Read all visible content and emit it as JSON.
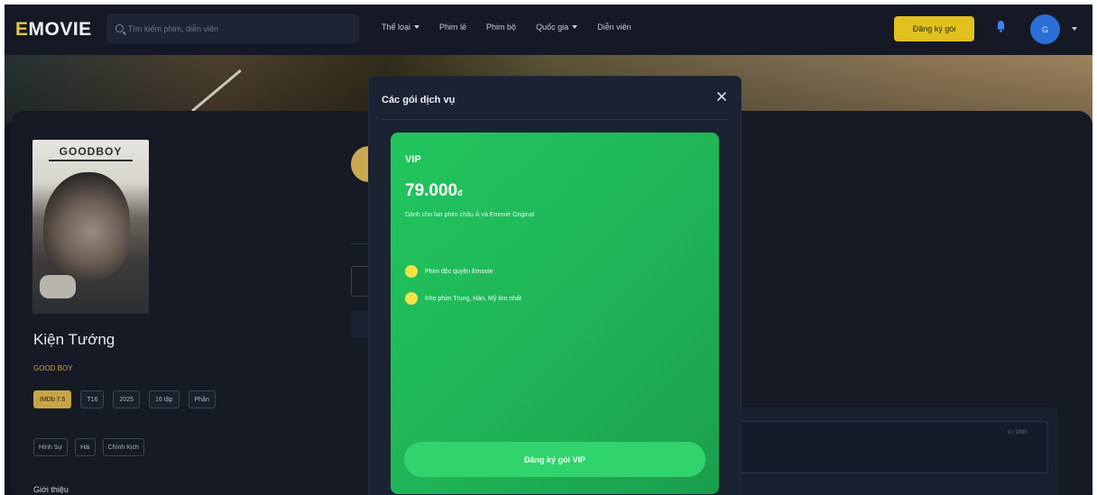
{
  "header": {
    "logo_first_letter": "E",
    "logo_rest": "MOVIE",
    "search_placeholder": "Tìm kiếm phim, diễn viên",
    "menu": [
      {
        "label": "Thể loại",
        "has_caret": true
      },
      {
        "label": "Phim lẻ",
        "has_caret": false
      },
      {
        "label": "Phim bộ",
        "has_caret": false
      },
      {
        "label": "Quốc gia",
        "has_caret": true
      },
      {
        "label": "Diễn viên",
        "has_caret": false
      }
    ],
    "signup_button": "Đăng ký gói",
    "avatar_initial": "G",
    "notification_icon": "bell-icon"
  },
  "movie": {
    "poster_title": "GOODBOY",
    "title": "Kiện Tướng",
    "subtitle": "GOOD BOY",
    "tags": [
      "IMDb 7.5",
      "T16",
      "2025",
      "16 tập",
      "Phần"
    ],
    "genres": [
      "Hình Sự",
      "Hài",
      "Chính Kịch"
    ],
    "intro_label": "Giới thiệu",
    "comment_count": "0 / 1000"
  },
  "modal": {
    "title": "Các gói dịch vụ",
    "close_icon": "close-icon",
    "plan": {
      "name": "VIP",
      "price": "79.000",
      "currency": "đ",
      "description": "Dành cho fan phim châu Á và Emovie Original",
      "features": [
        "Phim độc quyền Emovie",
        "Kho phim Trung, Hàn, Mỹ lớn nhất"
      ],
      "button": "Đăng ký gói VIP",
      "card_color": "#22c55e",
      "check_color": "#f3e14a"
    }
  },
  "colors": {
    "accent_yellow": "#e0c11f",
    "avatar_blue": "#2b6fd6",
    "background": "#10141d"
  }
}
